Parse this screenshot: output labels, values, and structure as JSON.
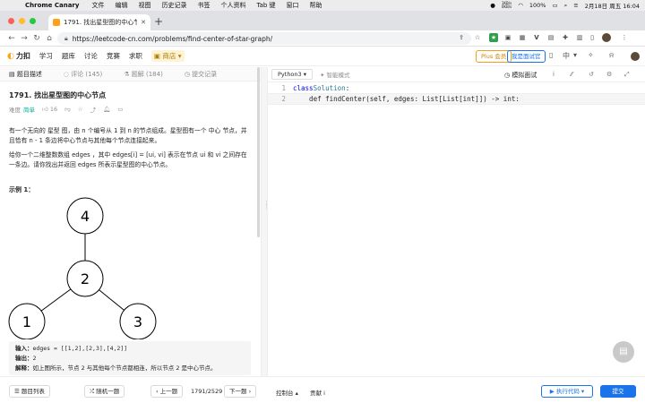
{
  "menubar": {
    "app": "Chrome Canary",
    "items": [
      "文件",
      "编辑",
      "视图",
      "历史记录",
      "书签",
      "个人资料",
      "Tab 键",
      "窗口",
      "帮助"
    ],
    "net_up": "1KB/s",
    "net_down": "0KB/s",
    "battery": "100%",
    "datetime": "2月18日 周五  16:04"
  },
  "browser": {
    "tab_title": "1791. 找出星型图的中心节点 - 力",
    "url": "https://leetcode-cn.com/problems/find-center-of-star-graph/"
  },
  "nav": {
    "logo": "力扣",
    "items": [
      "学习",
      "题库",
      "讨论",
      "竞赛",
      "求职"
    ],
    "shop": "商店",
    "plus": "Plus 会员",
    "interviewer": "我是面试官",
    "lang": "中"
  },
  "subtabs": [
    "题目描述",
    "评论 (145)",
    "题解 (184)",
    "提交记录"
  ],
  "problem": {
    "title": "1791. 找出星型图的中心节点",
    "difficulty_label": "难度",
    "difficulty": "简单",
    "likes": "16",
    "p1": "有一个无向的 星型 图，由 n 个编号从 1 到 n 的节点组成。星型图有一个 中心 节点，并且恰有 n - 1 条边将中心节点与其他每个节点连接起来。",
    "p2": "给你一个二维整数数组 edges ，其中 edges[i] = [ui, vi] 表示在节点 ui 和 vi 之间存在一条边。请你找出并返回 edges 所表示星型图的中心节点。",
    "example_title": "示例 1：",
    "graph_nodes": [
      "4",
      "2",
      "1",
      "3"
    ],
    "input_label": "输入：",
    "input": "edges = [[1,2],[2,3],[4,2]]",
    "output_label": "输出：",
    "output": "2",
    "explain_label": "解释：",
    "explain": "如上图所示，节点 2 与其他每个节点都相连，所以节点 2 是中心节点。"
  },
  "editor": {
    "language": "Python3",
    "smart_mode": "智能模式",
    "mock": "模拟面试",
    "lines": [
      {
        "num": "1",
        "kw": "class",
        "rest_cls": "Solution",
        "tail": ":"
      },
      {
        "num": "2",
        "text": "    def findCenter(self, edges: List[List[int]]) -> int:"
      }
    ]
  },
  "bottom": {
    "list": "题目列表",
    "random": "随机一题",
    "prev": "上一题",
    "page": "1791/2529",
    "next": "下一题",
    "console": "控制台",
    "contribute": "贡献 i",
    "run": "执行代码",
    "submit": "提交"
  }
}
